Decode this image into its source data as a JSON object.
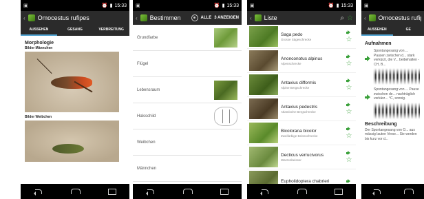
{
  "status": {
    "time": "15:33"
  },
  "screen1": {
    "title": "Omocestus rufipes",
    "tabs": [
      "AUSSEHEN",
      "GESANG",
      "VERBREITUNG"
    ],
    "section": "Morphologie",
    "images_male": "Bilder Männchen",
    "images_female": "Bilder Weibchen"
  },
  "screen2": {
    "title": "Bestimmen",
    "action_all": "ALLE",
    "action_show": "3 ANZEIGEN",
    "rows": [
      {
        "label": "Grundfarbe",
        "thumb": "grass"
      },
      {
        "label": "Flügel",
        "thumb": ""
      },
      {
        "label": "Lebensraum",
        "thumb": "insect"
      },
      {
        "label": "Halsschild",
        "thumb": "pronotum"
      },
      {
        "label": "Weibchen",
        "thumb": ""
      },
      {
        "label": "Männchen",
        "thumb": ""
      }
    ]
  },
  "screen3": {
    "title": "Liste",
    "items": [
      {
        "name": "Saga pedo",
        "common": "Grosse Sägeschrecke"
      },
      {
        "name": "Anonconotus alpinus",
        "common": "Alpenschrecke"
      },
      {
        "name": "Antaxius difformis",
        "common": "Alpine Bergschrecke"
      },
      {
        "name": "Antaxius pedestris",
        "common": "Atlantische Bergschrecke"
      },
      {
        "name": "Bicolorana bicolor",
        "common": "Zweifarbige Beissschrecke"
      },
      {
        "name": "Decticus verrucivorus",
        "common": "Warzenbeisser"
      },
      {
        "name": "Eupholidoptera chabrieri",
        "common": ""
      }
    ]
  },
  "screen4": {
    "title": "Omocestus rufipes",
    "tab_active": "AUSSEHEN",
    "tab2": "GE",
    "section_audio": "Aufnahmen",
    "audio1": "Spontangesang von ... Pausen zwischen d... stark verkürzt, die V... beibehalten - CH, B...",
    "audio2": "Spontangesang von ... Pause zwischen de... nachträglich verkürz... °C, sonnig.",
    "section_desc": "Beschreibung",
    "desc": "Der Spontangesang von O... aus mässig lauten Verse... Sie werden bis kurz vor d..."
  }
}
